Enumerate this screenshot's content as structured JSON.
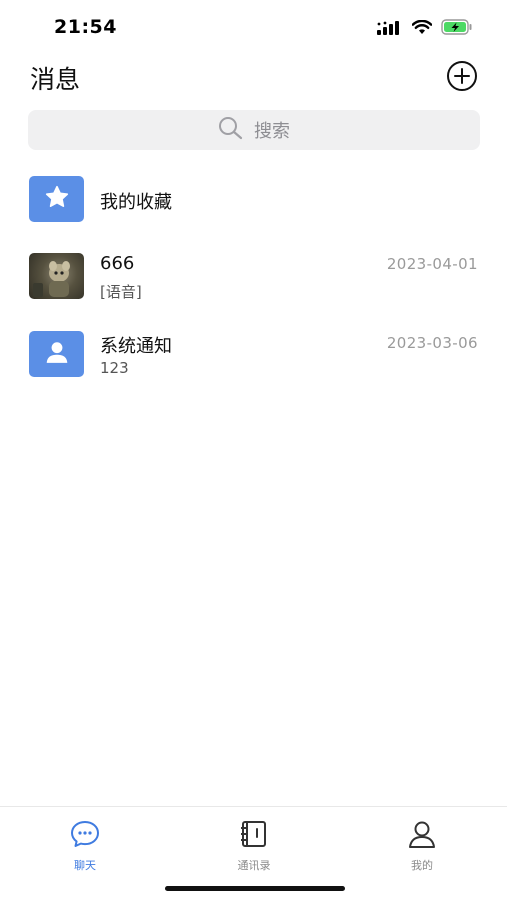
{
  "status_bar": {
    "time": "21:54",
    "icons": [
      "signal-icon",
      "wifi-icon",
      "battery-charging-icon"
    ],
    "battery_color": "#4cd964"
  },
  "header": {
    "title": "消息",
    "add_icon": "plus-circle-icon"
  },
  "search": {
    "placeholder": "搜索",
    "icon": "search-icon"
  },
  "conversations": [
    {
      "name": "我的收藏",
      "preview": "",
      "date": "",
      "avatar": "star-icon"
    },
    {
      "name": "666",
      "preview": "[语音]",
      "date": "2023-04-01",
      "avatar": "photo-avatar"
    },
    {
      "name": "系统通知",
      "preview": "123",
      "date": "2023-03-06",
      "avatar": "person-icon"
    }
  ],
  "tabs": [
    {
      "label": "聊天",
      "icon": "chat-bubble-icon",
      "active": true
    },
    {
      "label": "通讯录",
      "icon": "contacts-book-icon",
      "active": false
    },
    {
      "label": "我的",
      "icon": "profile-icon",
      "active": false
    }
  ],
  "colors": {
    "accent": "#3f7be0",
    "avatar_blue": "#5b8fe6",
    "search_bg": "#f0f0f1",
    "muted_text": "#9a9a9a"
  }
}
